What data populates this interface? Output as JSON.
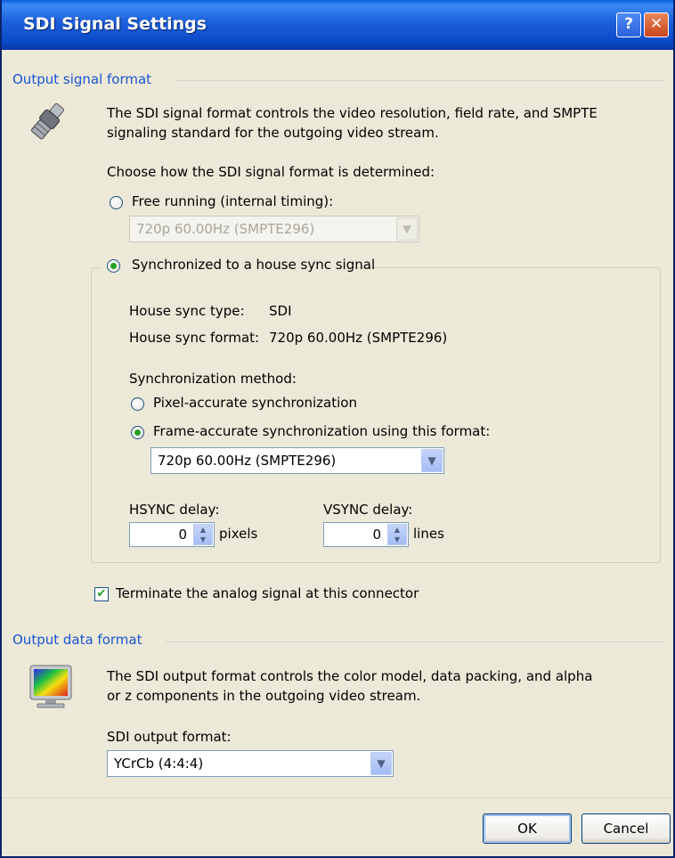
{
  "window": {
    "title": "SDI Signal Settings",
    "help_button": "?",
    "close_button": "✕"
  },
  "output_signal": {
    "group_title": "Output signal format",
    "icon": "connector-icon",
    "description_line1": "The SDI signal format controls the video resolution, field rate, and SMPTE",
    "description_line2": "signaling standard for the outgoing video stream.",
    "choose_label": "Choose how the SDI signal format is determined:",
    "free_running": {
      "label": "Free running (internal timing):",
      "selected": false,
      "combo_value": "720p 60.00Hz (SMPTE296)",
      "enabled": false
    },
    "synchronized": {
      "label": "Synchronized to a house sync signal",
      "selected": true,
      "house_sync_type_label": "House sync type:",
      "house_sync_type_value": "SDI",
      "house_sync_format_label": "House sync format:",
      "house_sync_format_value": "720p 60.00Hz (SMPTE296)",
      "method_label": "Synchronization method:",
      "pixel_accurate": {
        "label": "Pixel-accurate synchronization",
        "selected": false
      },
      "frame_accurate": {
        "label": "Frame-accurate synchronization using this format:",
        "selected": true,
        "combo_value": "720p 60.00Hz (SMPTE296)"
      },
      "hsync": {
        "label": "HSYNC delay:",
        "value": "0",
        "unit": "pixels"
      },
      "vsync": {
        "label": "VSYNC delay:",
        "value": "0",
        "unit": "lines"
      }
    },
    "terminate": {
      "label": "Terminate the analog signal at this connector",
      "checked": true
    }
  },
  "output_data": {
    "group_title": "Output data format",
    "icon": "monitor-icon",
    "description_line1": "The SDI output format controls the color model, data packing, and alpha",
    "description_line2": "or z components in the outgoing video stream.",
    "format_label": "SDI output format:",
    "format_value": "YCrCb (4:4:4)"
  },
  "buttons": {
    "ok": "OK",
    "cancel": "Cancel"
  },
  "colors": {
    "titlebar": "#0A48C6",
    "group_title": "#1A55D2",
    "dialog_bg": "#ECE9D8",
    "radio_dot": "#21A121"
  }
}
